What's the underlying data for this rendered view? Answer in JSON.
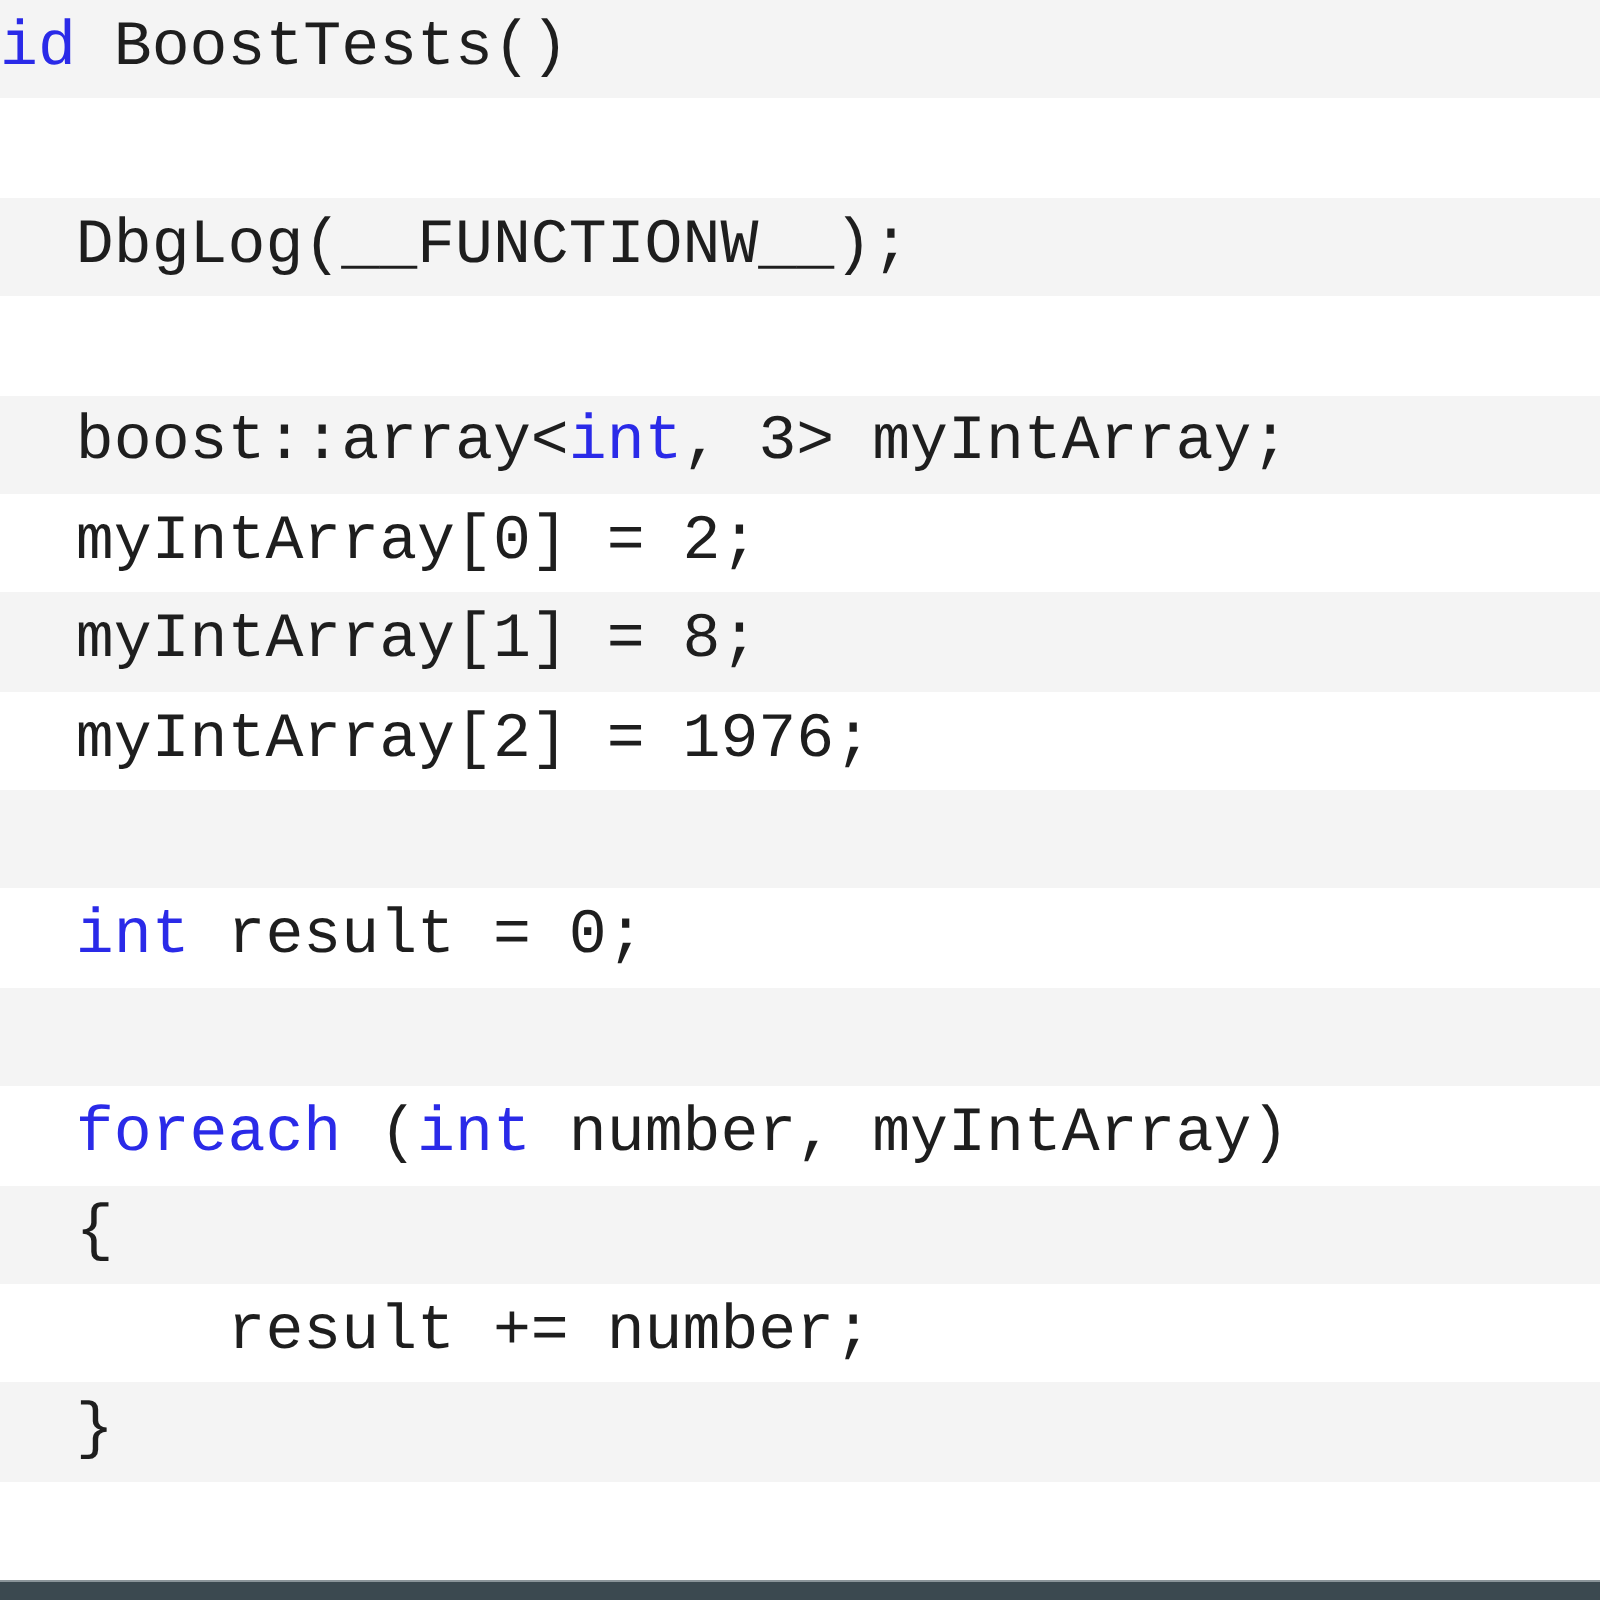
{
  "code_lines": [
    {
      "kind": "code",
      "tokens": [
        {
          "kind": "keyword",
          "text": "id"
        },
        {
          "kind": "plain",
          "text": " BoostTests()"
        }
      ],
      "children": [
        {
          "kind": "blank"
        },
        {
          "kind": "code",
          "tokens": [
            {
              "kind": "plain",
              "text": "DbgLog(__FUNCTIONW__);"
            }
          ]
        },
        {
          "kind": "blank"
        },
        {
          "kind": "code",
          "tokens": [
            {
              "kind": "plain",
              "text": "boost::array<"
            },
            {
              "kind": "keyword",
              "text": "int"
            },
            {
              "kind": "plain",
              "text": ", 3> myIntArray;"
            }
          ]
        },
        {
          "kind": "code",
          "tokens": [
            {
              "kind": "plain",
              "text": "myIntArray[0] = 2;"
            }
          ]
        },
        {
          "kind": "code",
          "tokens": [
            {
              "kind": "plain",
              "text": "myIntArray[1] = 8;"
            }
          ]
        },
        {
          "kind": "code",
          "tokens": [
            {
              "kind": "plain",
              "text": "myIntArray[2] = 1976;"
            }
          ]
        },
        {
          "kind": "blank"
        },
        {
          "kind": "code",
          "tokens": [
            {
              "kind": "keyword",
              "text": "int"
            },
            {
              "kind": "plain",
              "text": " result = 0;"
            }
          ]
        },
        {
          "kind": "blank"
        },
        {
          "kind": "code",
          "tokens": [
            {
              "kind": "keyword",
              "text": "foreach"
            },
            {
              "kind": "plain",
              "text": " ("
            },
            {
              "kind": "keyword",
              "text": "int"
            },
            {
              "kind": "plain",
              "text": " number, myIntArray)"
            }
          ]
        },
        {
          "kind": "code",
          "tokens": [
            {
              "kind": "plain",
              "text": "{"
            }
          ],
          "children": [
            {
              "kind": "code",
              "tokens": [
                {
                  "kind": "plain",
                  "text": "result += number;"
                }
              ]
            }
          ]
        },
        {
          "kind": "code",
          "tokens": [
            {
              "kind": "plain",
              "text": "}"
            }
          ]
        },
        {
          "kind": "blank"
        }
      ]
    }
  ]
}
